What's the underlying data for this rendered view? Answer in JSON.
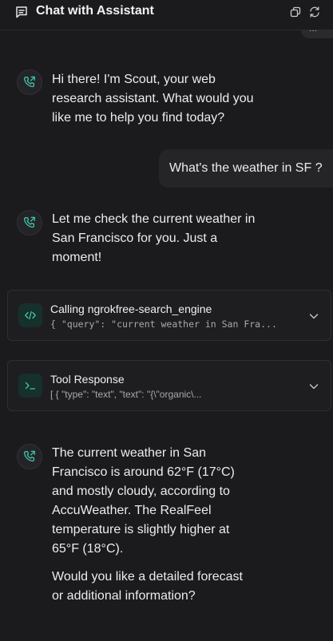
{
  "header": {
    "title": "Chat with Assistant"
  },
  "icons": {
    "chat": "message-square-icon",
    "assistant": "phone-call-icon",
    "code": "code-icon",
    "terminal": "terminal-icon",
    "chevron": "chevron-down-icon",
    "copy": "copy-icon",
    "refresh": "refresh-icon"
  },
  "colors": {
    "background": "#1b1b1d",
    "accent": "#3fc5a8",
    "bubble": "#252528",
    "tool_icon_bg": "#16302c"
  },
  "messages": {
    "prev_user_partial": "...",
    "assistant_1": "Hi there! I'm Scout, your web research assistant. What would you like me to help you find today?",
    "user_1": "What's the weather in SF ?",
    "assistant_2": "Let me check the current weather in San Francisco for you. Just a moment!",
    "tool_call": {
      "title": "Calling ngrokfree-search_engine",
      "preview": "{ \"query\": \"current weather in San Fra..."
    },
    "tool_response": {
      "title": "Tool Response",
      "preview": "[ { \"type\": \"text\", \"text\": \"{\\\"organic\\..."
    },
    "assistant_3": {
      "paragraph_1": "The current weather in San Francisco is around 62°F (17°C) and mostly cloudy, according to AccuWeather. The RealFeel temperature is slightly higher at 65°F (18°C).",
      "paragraph_2": "Would you like a detailed forecast or additional information?"
    }
  }
}
